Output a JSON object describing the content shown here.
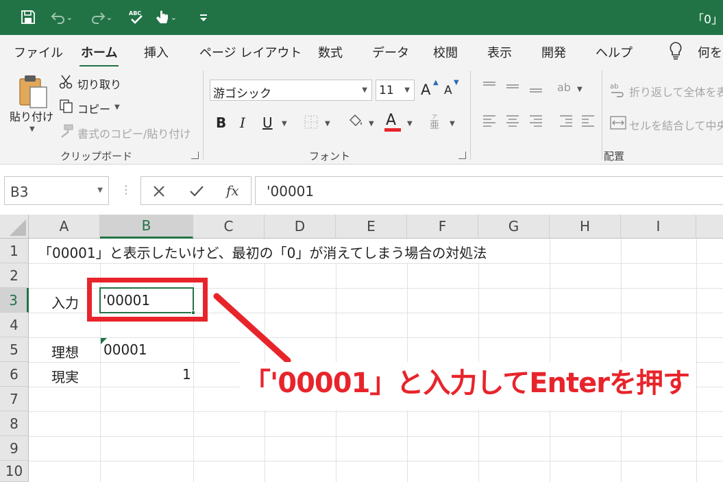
{
  "window": {
    "title": "「0」"
  },
  "ribbon_tabs": [
    "ファイル",
    "ホーム",
    "挿入",
    "ページ レイアウト",
    "数式",
    "データ",
    "校閲",
    "表示",
    "開発",
    "ヘルプ"
  ],
  "tell_me": "何をし",
  "clipboard": {
    "paste": "貼り付け",
    "cut": "切り取り",
    "copy": "コピー",
    "format_painter": "書式のコピー/貼り付け",
    "group": "クリップボード"
  },
  "font": {
    "name": "游ゴシック",
    "size": "11",
    "grow": "A",
    "shrink": "A",
    "bold": "B",
    "italic": "I",
    "underline": "U",
    "font_color_letter": "A",
    "group": "フォント"
  },
  "alignment": {
    "wrap_text": "折り返して全体を表",
    "merge_center": "セルを結合して中央",
    "group": "配置"
  },
  "formula_bar": {
    "name_box": "B3",
    "fx": "fx",
    "value": "'00001"
  },
  "grid": {
    "columns": [
      "A",
      "B",
      "C",
      "D",
      "E",
      "F",
      "G",
      "H",
      "I"
    ],
    "rows": [
      "1",
      "2",
      "3",
      "4",
      "5",
      "6",
      "7",
      "8",
      "9",
      "10"
    ],
    "cells": {
      "A1": "「00001」と表示したいけど、最初の「0」が消えてしまう場合の対処法",
      "A3": "入力",
      "B3": "'00001",
      "A5": "理想",
      "B5": "00001",
      "A6": "現実",
      "B6": "1"
    }
  },
  "annotation": "「'00001」と入力してEnterを押す",
  "colors": {
    "excel_green": "#217346",
    "callout_red": "#e8242b"
  }
}
